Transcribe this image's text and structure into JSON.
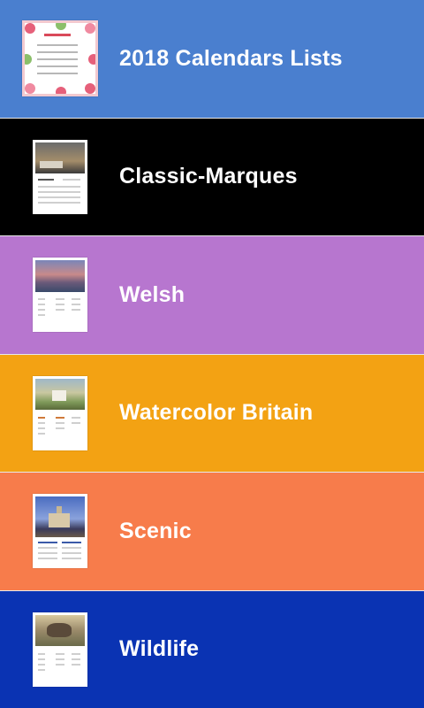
{
  "items": [
    {
      "label": "2018 Calendars Lists",
      "bg": "#4a7fcf",
      "thumb_icon": "floral-calendar-thumbnail"
    },
    {
      "label": "Classic-Marques",
      "bg": "#000000",
      "thumb_icon": "classic-car-calendar-thumbnail"
    },
    {
      "label": "Welsh",
      "bg": "#b776cf",
      "thumb_icon": "welsh-landscape-calendar-thumbnail"
    },
    {
      "label": "Watercolor Britain",
      "bg": "#f3a213",
      "thumb_icon": "watercolor-cottage-calendar-thumbnail"
    },
    {
      "label": "Scenic",
      "bg": "#f77c4b",
      "thumb_icon": "scenic-building-calendar-thumbnail"
    },
    {
      "label": "Wildlife",
      "bg": "#0a33b3",
      "thumb_icon": "wildlife-animal-calendar-thumbnail"
    }
  ]
}
